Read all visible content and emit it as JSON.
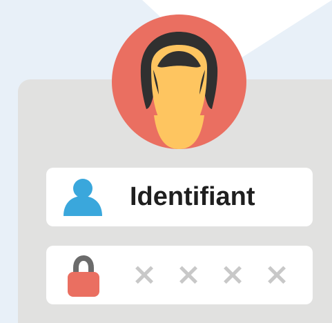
{
  "login_card": {
    "username_field": {
      "label": "Identifiant",
      "icon": "user-icon"
    },
    "password_field": {
      "masked": [
        "×",
        "×",
        "×",
        "×"
      ],
      "icon": "lock-icon"
    },
    "avatar": {
      "icon": "male-avatar-icon"
    }
  },
  "colors": {
    "page_background": "#ffffff",
    "background_shape": "#e8f0f8",
    "card_background": "#e1e1e0",
    "field_background": "#ffffff",
    "avatar_circle": "#ea6f61",
    "skin": "#fec560",
    "hair": "#303030",
    "user_icon": "#3aa7dc",
    "lock_body": "#ea6f61",
    "lock_shackle": "#6b6b6b",
    "label_text": "#1f1f1f",
    "mask_text": "#c8c8c8"
  }
}
